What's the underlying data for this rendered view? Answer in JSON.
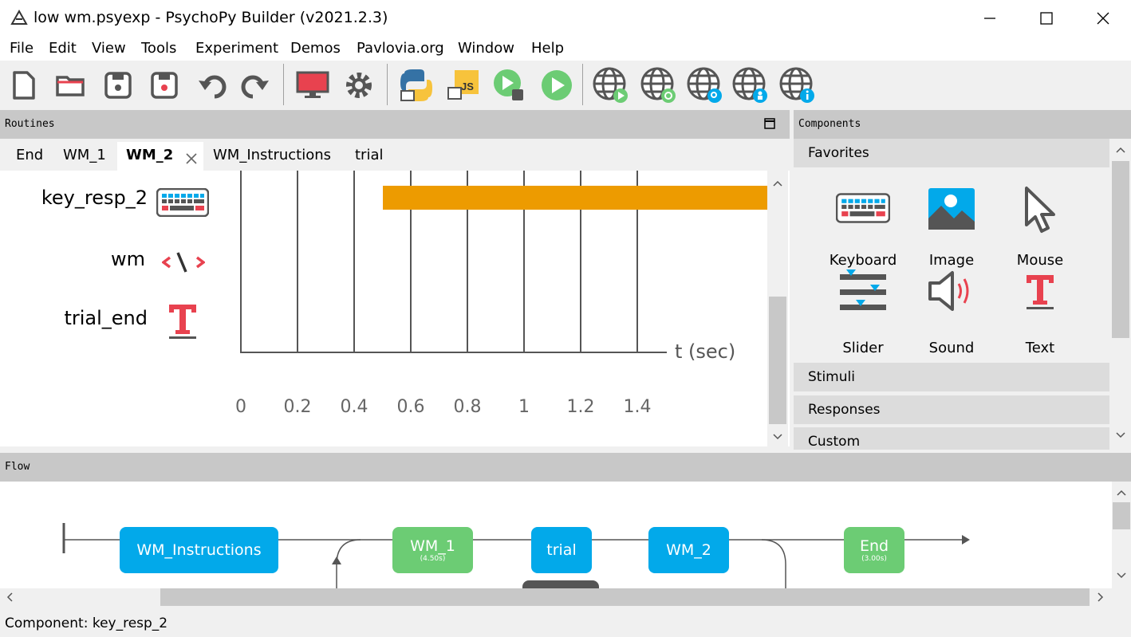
{
  "window": {
    "title": "low wm.psyexp - PsychoPy Builder (v2021.2.3)"
  },
  "menu": [
    "File",
    "Edit",
    "View",
    "Tools",
    "Experiment",
    "Demos",
    "Pavlovia.org",
    "Window",
    "Help"
  ],
  "toolbar": {
    "icons": [
      "new-file-icon",
      "open-folder-icon",
      "save-icon",
      "save-as-icon",
      "undo-icon",
      "redo-icon",
      "monitor-icon",
      "gear-icon",
      "python-icon",
      "js-icon",
      "run-local-icon",
      "run-icon",
      "pavlovia-run-icon",
      "pavlovia-sync-icon",
      "pavlovia-search-icon",
      "pavlovia-user-icon",
      "pavlovia-info-icon"
    ]
  },
  "routines": {
    "header": "Routines",
    "tabs": [
      "End",
      "WM_1",
      "WM_2",
      "WM_Instructions",
      "trial"
    ],
    "active_tab": "WM_2",
    "components": [
      {
        "name": "key_resp_2",
        "icon": "keyboard-icon"
      },
      {
        "name": "wm",
        "icon": "code-icon"
      },
      {
        "name": "trial_end",
        "icon": "text-icon"
      }
    ],
    "timeline": {
      "ticks": [
        "0",
        "0.2",
        "0.4",
        "0.6",
        "0.8",
        "1",
        "1.2",
        "1.4"
      ],
      "axis_label": "t (sec)",
      "bar": {
        "component": "key_resp_2",
        "start": 0.5,
        "color": "#ed9b00"
      }
    }
  },
  "components_panel": {
    "header": "Components",
    "categories": [
      "Favorites",
      "Stimuli",
      "Responses",
      "Custom"
    ],
    "favorites": [
      {
        "label": "Keyboard",
        "icon": "keyboard-icon"
      },
      {
        "label": "Image",
        "icon": "image-icon"
      },
      {
        "label": "Mouse",
        "icon": "mouse-icon"
      },
      {
        "label": "Slider",
        "icon": "slider-icon"
      },
      {
        "label": "Sound",
        "icon": "sound-icon"
      },
      {
        "label": "Text",
        "icon": "text-icon"
      }
    ]
  },
  "flow": {
    "header": "Flow",
    "items": [
      {
        "label": "WM_Instructions",
        "duration": "",
        "color": "#02a9ea"
      },
      {
        "label": "WM_1",
        "duration": "(4.50s)",
        "color": "#6ccc74"
      },
      {
        "label": "trial",
        "duration": "",
        "color": "#02a9ea"
      },
      {
        "label": "WM_2",
        "duration": "",
        "color": "#02a9ea"
      },
      {
        "label": "End",
        "duration": "(3.00s)",
        "color": "#6ccc74"
      }
    ]
  },
  "status": {
    "text": "Component: key_resp_2"
  },
  "colors": {
    "accent_orange": "#ed9b00",
    "flow_blue": "#02a9ea",
    "flow_green": "#6ccc74",
    "icon_red": "#e8424f"
  }
}
